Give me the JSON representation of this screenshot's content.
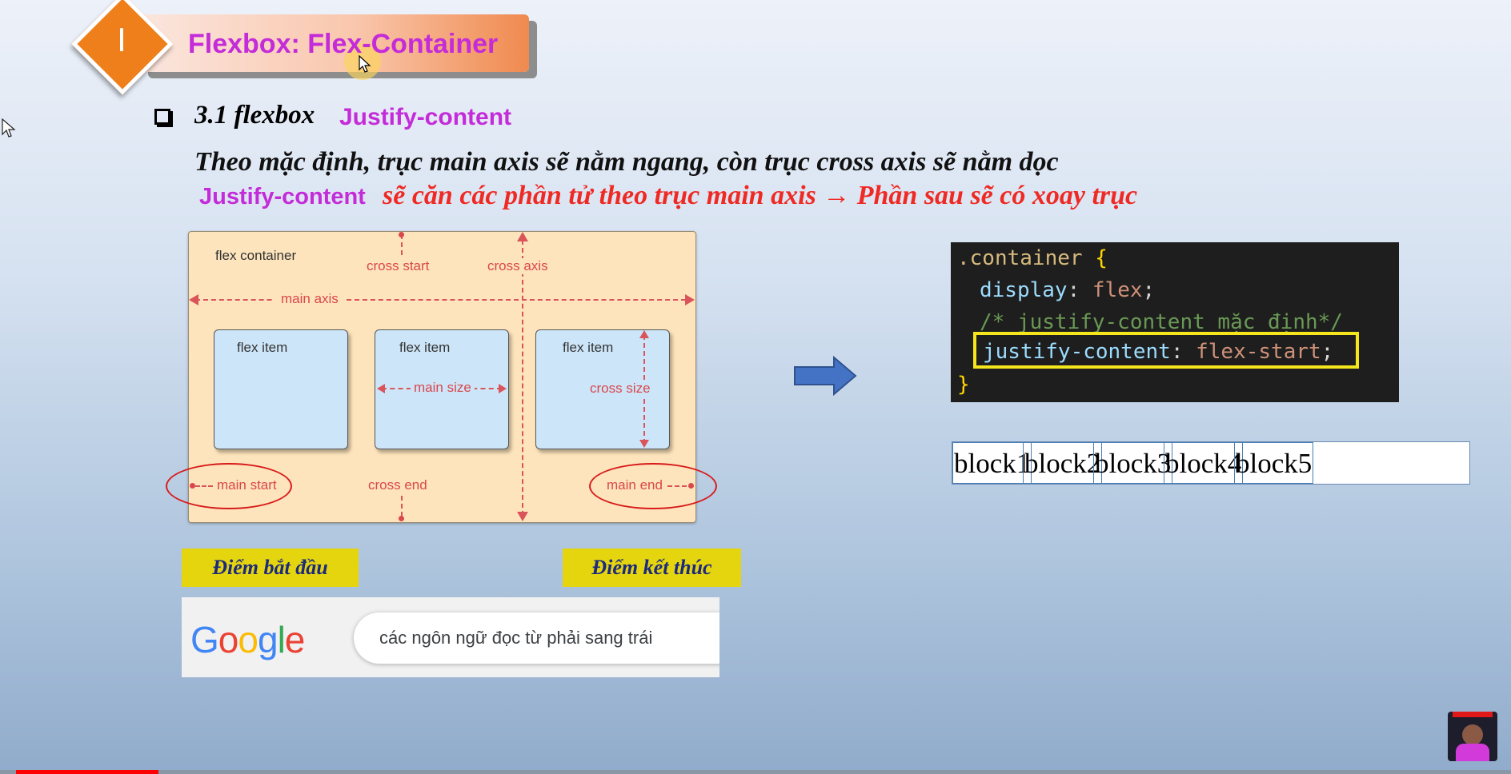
{
  "header": {
    "number": "I",
    "title": "Flexbox: Flex-Container"
  },
  "section": {
    "number": "3.1 flexbox",
    "property": "Justify-content"
  },
  "description": {
    "line1": "Theo mặc định, trục main axis sẽ nằm ngang, còn trục cross axis sẽ nằm dọc",
    "line2_prop": "Justify-content",
    "line2_rest": "sẽ căn các phần tử theo trục main axis  → Phần sau sẽ có xoay trục"
  },
  "diagram": {
    "container_label": "flex container",
    "item_label": "flex item",
    "cross_start": "cross start",
    "cross_axis": "cross axis",
    "main_axis": "main axis",
    "main_size": "main size",
    "cross_size": "cross size",
    "main_start": "main start",
    "cross_end": "cross end",
    "main_end": "main end"
  },
  "labels": {
    "start": "Điểm bắt đầu",
    "end": "Điểm kết thúc"
  },
  "google": {
    "logo": [
      "G",
      "o",
      "o",
      "g",
      "l",
      "e"
    ],
    "query": "các ngôn ngữ đọc từ phải sang trái"
  },
  "code": {
    "line1_selector": ".container",
    "line1_brace": " {",
    "line2_prop": "display",
    "line2_colon": ": ",
    "line2_value": "flex",
    "line2_semi": ";",
    "line3_comment": "/* justify-content mặc định*/",
    "line4_prop": "justify-content",
    "line4_colon": ": ",
    "line4_value": "flex-start",
    "line4_semi": ";",
    "line5_brace": "}"
  },
  "blocks": [
    "block1",
    "block2",
    "block3",
    "block4",
    "block5"
  ],
  "colors": {
    "accent_magenta": "#c42bd9",
    "accent_red": "#ef2a24",
    "diamond": "#ef7f1a",
    "highlight_yellow": "#e5d50e"
  },
  "icons": [
    "checkbox-bullet-icon",
    "right-arrow-icon",
    "mouse-cursor-icon",
    "channel-avatar-icon"
  ]
}
